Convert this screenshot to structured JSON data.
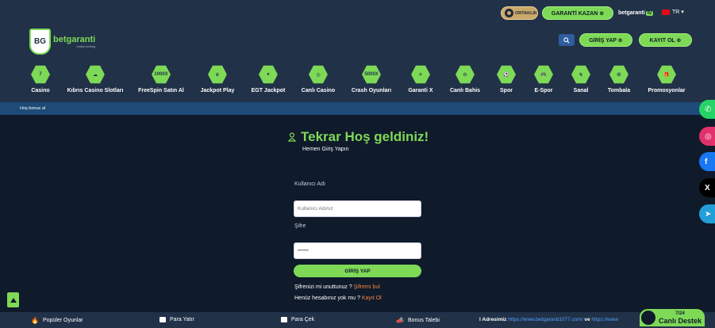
{
  "header": {
    "ortaklik": "ORTAKLIK",
    "garanti_kazan": "GARANTİ KAZAN ⊕",
    "tv_brand": "betgaranti",
    "tv_badge": "tv",
    "lang": "TR ▾",
    "logo_brand": "betgaranti",
    "logo_tag": "online betting",
    "login_label": "GİRİŞ YAP ⊕",
    "register_label": "KAYIT OL ⊕"
  },
  "nav": [
    {
      "label": "Casino",
      "glyph": "7"
    },
    {
      "label": "Kıbrıs Casino Slotları",
      "glyph": "☁"
    },
    {
      "label": "FreeSpin Satın Al",
      "glyph": "1000X"
    },
    {
      "label": "Jackpot Play",
      "glyph": "♛"
    },
    {
      "label": "EGT Jackpot",
      "glyph": "♠"
    },
    {
      "label": "Canlı Casino",
      "glyph": "◎"
    },
    {
      "label": "Crash Oyunları",
      "glyph": "5000X"
    },
    {
      "label": "Garanti X",
      "glyph": "✈"
    },
    {
      "label": "Canlı Bahis",
      "glyph": "⚙"
    },
    {
      "label": "Spor",
      "glyph": "⚽"
    },
    {
      "label": "E-Spor",
      "glyph": "🎮"
    },
    {
      "label": "Sanal",
      "glyph": "↯"
    },
    {
      "label": "Tombala",
      "glyph": "❂"
    },
    {
      "label": "Promosyonlar",
      "glyph": "🎁"
    }
  ],
  "marquee": "Hoş bonus al",
  "login": {
    "title": "Tekrar Hoş geldiniz!",
    "subtitle": "Hemen Giriş Yapın",
    "username_label": "Kullanıcı Adı",
    "username_placeholder": "Kullanıcı Adınız",
    "password_label": "Şifre",
    "password_value": "••••••",
    "submit_label": "GİRİŞ YAP",
    "forgot_text": "Şifrenizi mi unuttunuz ?",
    "forgot_link": "Şifremi bul",
    "register_text": "Henüz hesabınız yok mu ?",
    "register_link": "Kayıt Ol"
  },
  "social": {
    "whatsapp": "✆",
    "instagram": "◎",
    "facebook": "f",
    "x": "X",
    "telegram": "➤"
  },
  "footer": {
    "popular": "Popüler Oyunlar",
    "deposit": "Para Yatır",
    "withdraw": "Para Çek",
    "bonus": "Bonus Talebi",
    "ticker_prefix": "l Adresimiz",
    "ticker_link1": "https://www.betgaranti1077.com/",
    "ticker_mid": "ve",
    "ticker_link2": "https://www",
    "live_hours": "7/24",
    "live_label": "Canlı Destek"
  },
  "colors": {
    "accent": "#7ed957",
    "header": "#213148",
    "background": "#0f1a2a",
    "link": "#f0883e"
  }
}
